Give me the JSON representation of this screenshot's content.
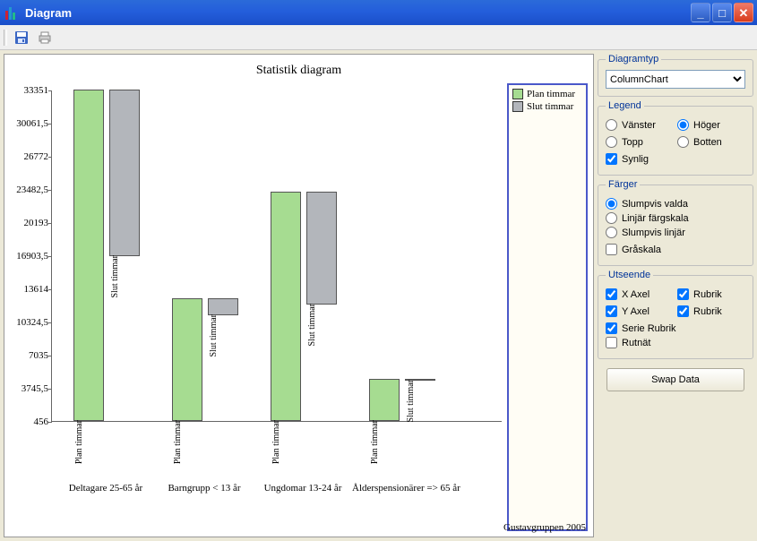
{
  "window": {
    "title": "Diagram"
  },
  "toolbar": {
    "save_label": "Save",
    "print_label": "Print"
  },
  "chart_data": {
    "type": "bar",
    "title": "Statistik diagram",
    "series": [
      {
        "name": "Plan timmar",
        "color": "#a6dc91",
        "values": [
          33351,
          12600,
          23200,
          4600
        ]
      },
      {
        "name": "Slut timmar",
        "color": "#b3b6bb",
        "values": [
          17000,
          2100,
          11600,
          0
        ]
      }
    ],
    "categories": [
      "Deltagare 25-65 år",
      "Barngrupp < 13 år",
      "Ungdomar 13-24 år",
      "Ålderspensionärer => 65 år"
    ],
    "ylim": [
      456,
      33351
    ],
    "yticks": [
      33351,
      30061.5,
      26772,
      23482.5,
      20193,
      16903.5,
      13614,
      10324.5,
      7035,
      3745.5,
      456
    ],
    "legend_position": "right",
    "footer": "Gustavgruppen 2005"
  },
  "panel": {
    "diagramtyp": {
      "legend": "Diagramtyp",
      "selected": "ColumnChart"
    },
    "legend_group": {
      "legend": "Legend",
      "vanster": "Vänster",
      "hoger": "Höger",
      "topp": "Topp",
      "botten": "Botten",
      "synlig": "Synlig",
      "pos_selected": "hoger",
      "visible": true
    },
    "farger": {
      "legend": "Färger",
      "slumpvis_valda": "Slumpvis valda",
      "linjar_fargskala": "Linjär färgskala",
      "slumpvis_linjar": "Slumpvis linjär",
      "graskala": "Gråskala",
      "selected": "slumpvis_valda",
      "gray": false
    },
    "utseende": {
      "legend": "Utseende",
      "x_axel": "X Axel",
      "y_axel": "Y Axel",
      "serie_rubrik": "Serie Rubrik",
      "rubrik1": "Rubrik",
      "rubrik2": "Rubrik",
      "rutnat": "Rutnät",
      "x_checked": true,
      "y_checked": true,
      "serie_checked": true,
      "rubrik1_checked": true,
      "rubrik2_checked": true,
      "rutnat_checked": false
    },
    "swap": "Swap Data"
  }
}
